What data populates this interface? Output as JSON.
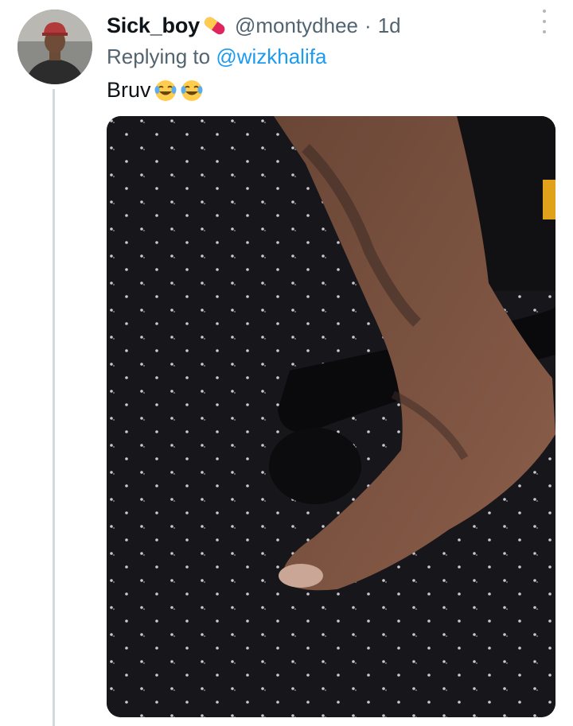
{
  "tweet": {
    "author": {
      "display_name": "Sick_boy",
      "name_badge_icon": "pill-icon",
      "handle": "@montydhee",
      "separator": "·",
      "timestamp": "1d",
      "avatar_icon": "avatar-photo"
    },
    "reply_context": {
      "prefix": "Replying to",
      "mention": "@wizkhalifa"
    },
    "text": "Bruv",
    "text_emojis": [
      "face-with-tears-of-joy-emoji",
      "face-with-tears-of-joy-emoji"
    ],
    "media": {
      "type": "photo"
    },
    "menu_icon": "more-options-icon"
  },
  "colors": {
    "primary_text": "#0f1419",
    "secondary_text": "#536471",
    "link": "#1d9bf0",
    "thread_line": "#cfd9de"
  }
}
